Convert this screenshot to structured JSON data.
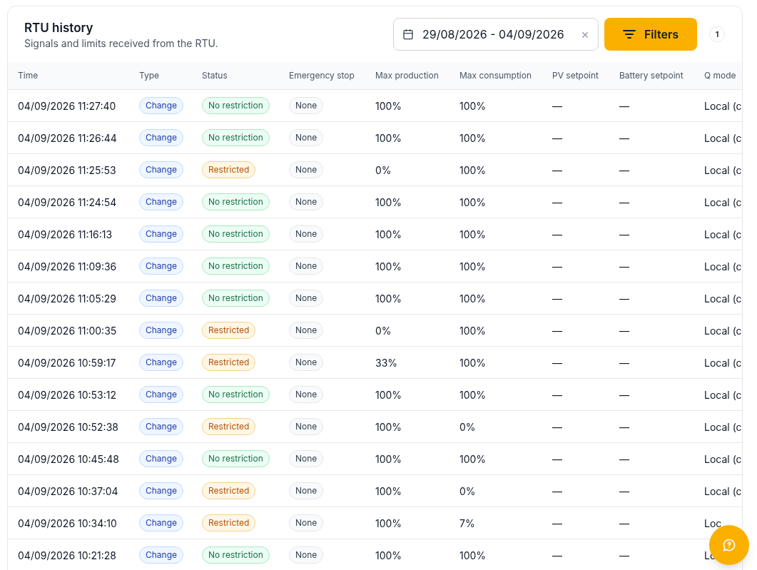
{
  "header": {
    "title": "RTU history",
    "subtitle": "Signals and limits received from the RTU."
  },
  "date_range": {
    "value": "29/08/2026 - 04/09/2026",
    "clear": "×"
  },
  "filters_button": {
    "label": "Filters",
    "count": "1"
  },
  "table": {
    "columns": [
      "Time",
      "Type",
      "Status",
      "Emergency stop",
      "Max production",
      "Max consumption",
      "PV setpoint",
      "Battery setpoint",
      "Q mode"
    ],
    "rows": [
      {
        "time": "04/09/2026 11:27:40",
        "type": "Change",
        "status": {
          "text": "No restriction",
          "kind": "ok"
        },
        "emergency_stop": "None",
        "max_production": "100%",
        "max_consumption": "100%",
        "pv_setpoint": "—",
        "battery_setpoint": "—",
        "q_mode": "Local (c"
      },
      {
        "time": "04/09/2026 11:26:44",
        "type": "Change",
        "status": {
          "text": "No restriction",
          "kind": "ok"
        },
        "emergency_stop": "None",
        "max_production": "100%",
        "max_consumption": "100%",
        "pv_setpoint": "—",
        "battery_setpoint": "—",
        "q_mode": "Local (c"
      },
      {
        "time": "04/09/2026 11:25:53",
        "type": "Change",
        "status": {
          "text": "Restricted",
          "kind": "restricted"
        },
        "emergency_stop": "None",
        "max_production": "0%",
        "max_consumption": "100%",
        "pv_setpoint": "—",
        "battery_setpoint": "—",
        "q_mode": "Local (c"
      },
      {
        "time": "04/09/2026 11:24:54",
        "type": "Change",
        "status": {
          "text": "No restriction",
          "kind": "ok"
        },
        "emergency_stop": "None",
        "max_production": "100%",
        "max_consumption": "100%",
        "pv_setpoint": "—",
        "battery_setpoint": "—",
        "q_mode": "Local (c"
      },
      {
        "time": "04/09/2026 11:16:13",
        "type": "Change",
        "status": {
          "text": "No restriction",
          "kind": "ok"
        },
        "emergency_stop": "None",
        "max_production": "100%",
        "max_consumption": "100%",
        "pv_setpoint": "—",
        "battery_setpoint": "—",
        "q_mode": "Local (c"
      },
      {
        "time": "04/09/2026 11:09:36",
        "type": "Change",
        "status": {
          "text": "No restriction",
          "kind": "ok"
        },
        "emergency_stop": "None",
        "max_production": "100%",
        "max_consumption": "100%",
        "pv_setpoint": "—",
        "battery_setpoint": "—",
        "q_mode": "Local (c"
      },
      {
        "time": "04/09/2026 11:05:29",
        "type": "Change",
        "status": {
          "text": "No restriction",
          "kind": "ok"
        },
        "emergency_stop": "None",
        "max_production": "100%",
        "max_consumption": "100%",
        "pv_setpoint": "—",
        "battery_setpoint": "—",
        "q_mode": "Local (c"
      },
      {
        "time": "04/09/2026 11:00:35",
        "type": "Change",
        "status": {
          "text": "Restricted",
          "kind": "restricted"
        },
        "emergency_stop": "None",
        "max_production": "0%",
        "max_consumption": "100%",
        "pv_setpoint": "—",
        "battery_setpoint": "—",
        "q_mode": "Local (c"
      },
      {
        "time": "04/09/2026 10:59:17",
        "type": "Change",
        "status": {
          "text": "Restricted",
          "kind": "restricted"
        },
        "emergency_stop": "None",
        "max_production": "33%",
        "max_consumption": "100%",
        "pv_setpoint": "—",
        "battery_setpoint": "—",
        "q_mode": "Local (c"
      },
      {
        "time": "04/09/2026 10:53:12",
        "type": "Change",
        "status": {
          "text": "No restriction",
          "kind": "ok"
        },
        "emergency_stop": "None",
        "max_production": "100%",
        "max_consumption": "100%",
        "pv_setpoint": "—",
        "battery_setpoint": "—",
        "q_mode": "Local (c"
      },
      {
        "time": "04/09/2026 10:52:38",
        "type": "Change",
        "status": {
          "text": "Restricted",
          "kind": "restricted"
        },
        "emergency_stop": "None",
        "max_production": "100%",
        "max_consumption": "0%",
        "pv_setpoint": "—",
        "battery_setpoint": "—",
        "q_mode": "Local (c"
      },
      {
        "time": "04/09/2026 10:45:48",
        "type": "Change",
        "status": {
          "text": "No restriction",
          "kind": "ok"
        },
        "emergency_stop": "None",
        "max_production": "100%",
        "max_consumption": "100%",
        "pv_setpoint": "—",
        "battery_setpoint": "—",
        "q_mode": "Local (c"
      },
      {
        "time": "04/09/2026 10:37:04",
        "type": "Change",
        "status": {
          "text": "Restricted",
          "kind": "restricted"
        },
        "emergency_stop": "None",
        "max_production": "100%",
        "max_consumption": "0%",
        "pv_setpoint": "—",
        "battery_setpoint": "—",
        "q_mode": "Local (c"
      },
      {
        "time": "04/09/2026 10:34:10",
        "type": "Change",
        "status": {
          "text": "Restricted",
          "kind": "restricted"
        },
        "emergency_stop": "None",
        "max_production": "100%",
        "max_consumption": "7%",
        "pv_setpoint": "—",
        "battery_setpoint": "—",
        "q_mode": "Loc"
      },
      {
        "time": "04/09/2026 10:21:28",
        "type": "Change",
        "status": {
          "text": "No restriction",
          "kind": "ok"
        },
        "emergency_stop": "None",
        "max_production": "100%",
        "max_consumption": "100%",
        "pv_setpoint": "—",
        "battery_setpoint": "—",
        "q_mode": "Lo"
      }
    ]
  }
}
